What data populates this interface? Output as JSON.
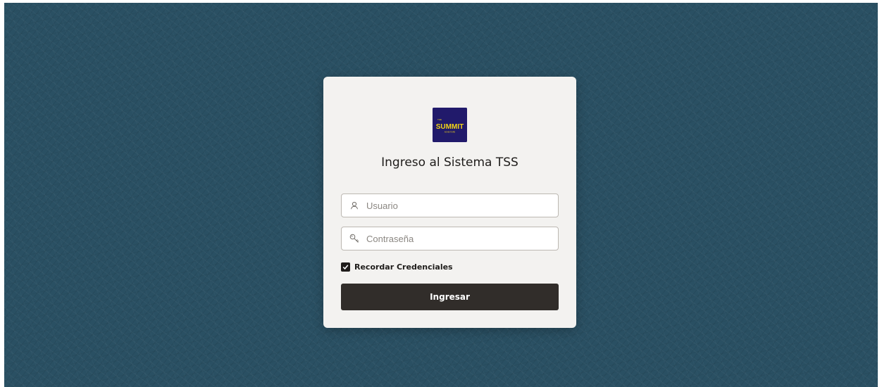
{
  "background": {
    "color": "#2a5063"
  },
  "card": {
    "background": "#f3f2f0"
  },
  "logo": {
    "top_text": "THE",
    "main_text": "SUMMIT",
    "sub_text": "ADVENTURE",
    "background": "#211a6b",
    "accent": "#f2d417"
  },
  "login": {
    "title": "Ingreso al Sistema TSS",
    "username_placeholder": "Usuario",
    "username_value": "",
    "username_icon": "user-icon",
    "password_placeholder": "Contraseña",
    "password_value": "",
    "password_icon": "key-icon",
    "remember_label": "Recordar Credenciales",
    "remember_checked": true,
    "submit_label": "Ingresar",
    "submit_color": "#312d2a"
  }
}
